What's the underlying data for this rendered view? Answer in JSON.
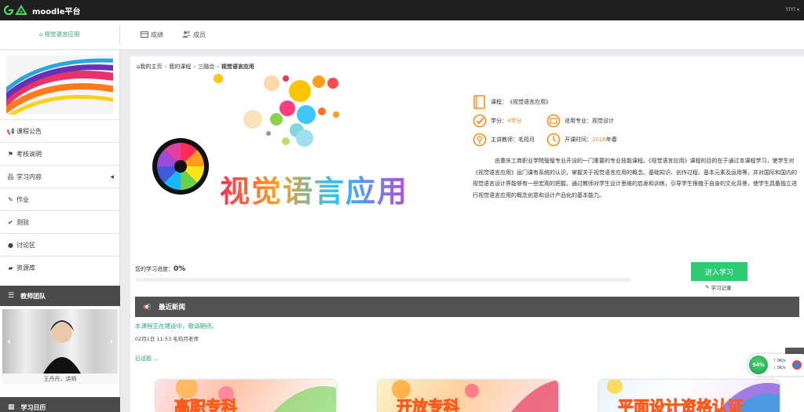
{
  "navbar": {
    "brand": "moodle平台",
    "user": "YIYI"
  },
  "subnav": {
    "course_link": "视觉语言应用",
    "tabs": [
      {
        "label": "成绩",
        "icon": "grades-icon"
      },
      {
        "label": "成员",
        "icon": "users-icon"
      }
    ]
  },
  "sidebar": {
    "menu": [
      {
        "label": "课程公告",
        "icon": "bullhorn-icon"
      },
      {
        "label": "考核说明",
        "icon": "flag-icon"
      },
      {
        "label": "学习内容",
        "icon": "sitemap-icon",
        "has_submenu": true
      },
      {
        "label": "作业",
        "icon": "edit-icon"
      },
      {
        "label": "测验",
        "icon": "check-icon"
      },
      {
        "label": "讨论区",
        "icon": "comments-icon"
      },
      {
        "label": "资源库",
        "icon": "folder-open-icon"
      }
    ],
    "teacher_panel_title": "教师团队",
    "teacher_name": "王丹丹，讲师",
    "calendar_panel_title": "学习日历"
  },
  "breadcrumb": [
    "我的主页",
    "我的课程",
    "三融合",
    "视觉语言应用"
  ],
  "hero": {
    "title": "视觉语言应用"
  },
  "info": {
    "course_label": "课程：",
    "course_value": "《视觉语言应用》",
    "credit_label": "学分：",
    "credit_value": "4学分",
    "major_label": "适用专业：",
    "major_value": "视觉设计",
    "teacher_label": "主讲教师：",
    "teacher_value": "毛筠月",
    "start_label": "开课时间：",
    "start_year": "2016",
    "start_season": "年春",
    "description": "由重庆工商职业学院璧璧专业开设的一门重要的专业技能课程。《视觉语言应用》课程的目的在于通过本课程学习，使学生对《视觉语言应用》运门课有系统的认识，掌握关于视觉语言应用的概念、基础知识、创作过程、基本元素及运用等，并对国际和国内的视觉语言设计界能够有一些宏观的把握。通过教师对学生设计思维的启发和训练，引导学生根植于自身的文化背景，使学生具备独立进行视觉语言应用的概念创意和设计产品化的基本能力。"
  },
  "progress": {
    "label": "您的学习进度：",
    "value": "0%",
    "fraction": 0
  },
  "actions": {
    "enter_label": "进入学习",
    "record_label": "学习记录"
  },
  "news": {
    "section_title": "最近新闻",
    "item_title": "本课程正在建设中，敬请期待。",
    "item_meta": "02月1日 11:53  毛筠月老师",
    "old_topics": "旧话题 ..."
  },
  "cards": [
    {
      "label": "高职专科"
    },
    {
      "label": "开放专科"
    },
    {
      "label": "平面设计资格认证"
    }
  ],
  "speed_widget": {
    "percent": "54%",
    "up": "0K/s",
    "down": "0K/s"
  },
  "colors": {
    "accent_green": "#2aa876",
    "button_green": "#2ecc71",
    "highlight_orange": "#ff8c1a",
    "dark_bar": "#525252"
  }
}
